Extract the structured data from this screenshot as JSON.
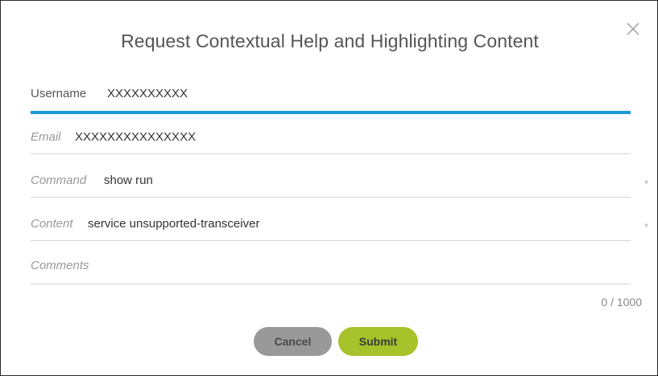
{
  "dialog": {
    "title": "Request Contextual Help and Highlighting Content",
    "close_icon": "close-icon"
  },
  "fields": {
    "username": {
      "label": "Username",
      "value": "XXXXXXXXXX"
    },
    "email": {
      "label": "Email",
      "value": "XXXXXXXXXXXXXXX"
    },
    "command": {
      "label": "Command",
      "value": "show run",
      "required_mark": "*"
    },
    "content": {
      "label": "Content",
      "value": "service unsupported-transceiver",
      "required_mark": "*"
    },
    "comments": {
      "label": "Comments",
      "value": ""
    }
  },
  "counter": "0 / 1000",
  "buttons": {
    "cancel": "Cancel",
    "submit": "Submit"
  },
  "colors": {
    "active_underline": "#1a9ad6",
    "submit_button": "#a7c22a",
    "cancel_button": "#999999"
  }
}
